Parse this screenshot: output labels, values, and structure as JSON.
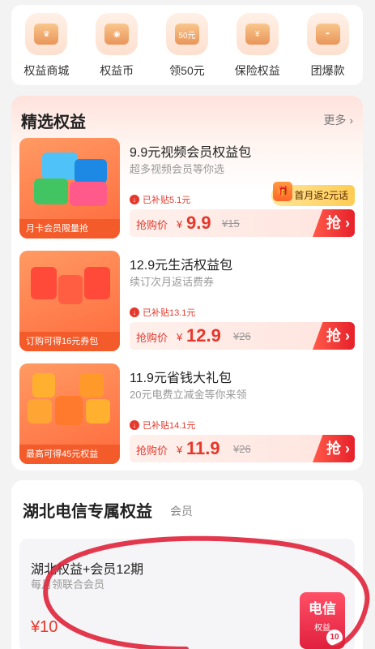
{
  "quick_entries": [
    {
      "label": "权益商城",
      "icon": "crown-icon",
      "glyph": "♛"
    },
    {
      "label": "权益币",
      "icon": "coin-icon",
      "glyph": "◉"
    },
    {
      "label": "领50元",
      "icon": "coupon-icon",
      "glyph": "50元"
    },
    {
      "label": "保险权益",
      "icon": "insurance-icon",
      "glyph": "¥"
    },
    {
      "label": "团爆款",
      "icon": "bowl-icon",
      "glyph": "◓"
    }
  ],
  "featured": {
    "title": "精选权益",
    "more": "更多 ›",
    "cards": [
      {
        "thumb_tag": "月卡会员限量抢",
        "title": "9.9元视频会员权益包",
        "subtitle": "超多视频会员等你选",
        "subsidy": "已补贴5.1元",
        "price_label": "抢购价",
        "yen": "¥",
        "price": "9.9",
        "original": "¥15",
        "button": "抢 ›",
        "promo": "首月返2元话",
        "promo_gift": "🎁"
      },
      {
        "thumb_tag": "订购可得16元券包",
        "title": "12.9元生活权益包",
        "subtitle": "续订次月返话费券",
        "subsidy": "已补贴13.1元",
        "price_label": "抢购价",
        "yen": "¥",
        "price": "12.9",
        "original": "¥26",
        "button": "抢 ›"
      },
      {
        "thumb_tag": "最高可得45元权益",
        "title": "11.9元省钱大礼包",
        "subtitle": "20元电费立减金等你来领",
        "subsidy": "已补贴14.1元",
        "price_label": "抢购价",
        "yen": "¥",
        "price": "11.9",
        "original": "¥26",
        "button": "抢 ›"
      }
    ]
  },
  "hubei": {
    "title": "湖北电信专属权益",
    "subtitle": "会员",
    "card": {
      "title": "湖北权益+会员12期",
      "subtitle": "每月领联合会员",
      "price": "¥10",
      "badge_main": "电信",
      "badge_sub": "权益",
      "badge_num": "10"
    }
  },
  "colors": {
    "accent_red": "#e5382c",
    "thumb_orange": "#ff7a45",
    "annotation_circle": "#e0243a"
  }
}
